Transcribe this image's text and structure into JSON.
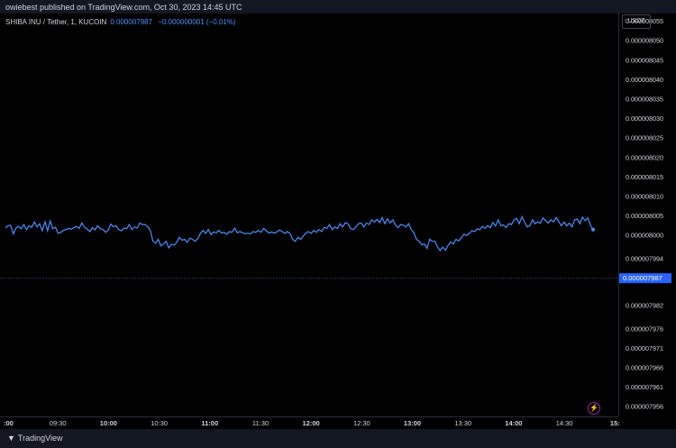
{
  "header": {
    "published_text": "owiebest published on TradingView.com, Oct 30, 2023 14:45 UTC"
  },
  "legend": {
    "symbol": "SHIBA INU / Tether, 1, KUCOIN",
    "value": "0.000007987",
    "change": "−0.000000001 (−0.01%)"
  },
  "scale": {
    "currency": "USDT"
  },
  "footer": {
    "brand": "TradingView"
  },
  "colors": {
    "line": "#4e8ff8",
    "background": "#000000",
    "panel": "#131722",
    "price_label": "#2962ff"
  },
  "chart_data": {
    "type": "line",
    "title": "",
    "xlabel": "",
    "ylabel": "",
    "ylim": [
      7.9535e-06,
      8.057e-06
    ],
    "y_ticks": [
      {
        "label": "0.000008055",
        "value": 8.055e-06
      },
      {
        "label": "0.000008050",
        "value": 8.05e-06
      },
      {
        "label": "0.000008045",
        "value": 8.045e-06
      },
      {
        "label": "0.000008040",
        "value": 8.04e-06
      },
      {
        "label": "0.000008035",
        "value": 8.035e-06
      },
      {
        "label": "0.000008030",
        "value": 8.03e-06
      },
      {
        "label": "0.000008025",
        "value": 8.025e-06
      },
      {
        "label": "0.000008020",
        "value": 8.02e-06
      },
      {
        "label": "0.000008015",
        "value": 8.015e-06
      },
      {
        "label": "0.000008010",
        "value": 8.01e-06
      },
      {
        "label": "0.000008005",
        "value": 8.005e-06
      },
      {
        "label": "0.000008000",
        "value": 8e-06
      },
      {
        "label": "0.000007994",
        "value": 7.994e-06
      },
      {
        "label": "0.000007982",
        "value": 7.982e-06
      },
      {
        "label": "0.000007976",
        "value": 7.976e-06
      },
      {
        "label": "0.000007971",
        "value": 7.971e-06
      },
      {
        "label": "0.000007966",
        "value": 7.966e-06
      },
      {
        "label": "0.000007961",
        "value": 7.961e-06
      },
      {
        "label": "0.000007956",
        "value": 7.956e-06
      }
    ],
    "last_price": {
      "label": "0.000007987",
      "value": 7.989e-06
    },
    "x_ticks": [
      {
        "label": ":00",
        "minute": 0,
        "bold": true
      },
      {
        "label": "09:30",
        "minute": 30,
        "bold": false
      },
      {
        "label": "10:00",
        "minute": 60,
        "bold": true
      },
      {
        "label": "10:30",
        "minute": 90,
        "bold": false
      },
      {
        "label": "11:00",
        "minute": 120,
        "bold": true
      },
      {
        "label": "11:30",
        "minute": 150,
        "bold": false
      },
      {
        "label": "12:00",
        "minute": 180,
        "bold": true
      },
      {
        "label": "12:30",
        "minute": 210,
        "bold": false
      },
      {
        "label": "13:00",
        "minute": 240,
        "bold": true
      },
      {
        "label": "13:30",
        "minute": 270,
        "bold": false
      },
      {
        "label": "14:00",
        "minute": 300,
        "bold": true
      },
      {
        "label": "14:30",
        "minute": 330,
        "bold": false
      },
      {
        "label": "15:",
        "minute": 360,
        "bold": true
      }
    ],
    "series": [
      {
        "points": [
          [
            0,
            8.0019e-06
          ],
          [
            1,
            8.0025e-06
          ],
          [
            2,
            8.0026e-06
          ],
          [
            3,
            8.0004e-06
          ],
          [
            4,
            8.0019e-06
          ],
          [
            5,
            8.0023e-06
          ],
          [
            6,
            8.0017e-06
          ],
          [
            7,
            8.0028e-06
          ],
          [
            8,
            8.0015e-06
          ],
          [
            9,
            8.0025e-06
          ],
          [
            10,
            8.0021e-06
          ],
          [
            11,
            8.0035e-06
          ],
          [
            12,
            8.0022e-06
          ],
          [
            13,
            8.003e-06
          ],
          [
            14,
            8.0012e-06
          ],
          [
            15,
            8.0035e-06
          ],
          [
            16,
            8.0012e-06
          ],
          [
            17,
            8.0037e-06
          ],
          [
            18,
            8.0017e-06
          ],
          [
            19,
            8.0021e-06
          ],
          [
            20,
            8.0005e-06
          ],
          [
            21,
            8.0008e-06
          ],
          [
            22,
            8.0013e-06
          ],
          [
            23,
            8.0015e-06
          ],
          [
            24,
            8.0018e-06
          ],
          [
            25,
            8.0016e-06
          ],
          [
            26,
            8.002e-06
          ],
          [
            27,
            8.0023e-06
          ],
          [
            28,
            8.0018e-06
          ],
          [
            29,
            8.0032e-06
          ],
          [
            30,
            8.0021e-06
          ],
          [
            31,
            8.0017e-06
          ],
          [
            32,
            8.001e-06
          ],
          [
            33,
            8.002e-06
          ],
          [
            34,
            8.0014e-06
          ],
          [
            35,
            8.0025e-06
          ],
          [
            36,
            8.0017e-06
          ],
          [
            37,
            8.0015e-06
          ],
          [
            38,
            8.0008e-06
          ],
          [
            39,
            8.0013e-06
          ],
          [
            40,
            8.0029e-06
          ],
          [
            41,
            8.0022e-06
          ],
          [
            42,
            8.0025e-06
          ],
          [
            43,
            8.0015e-06
          ],
          [
            44,
            8.0012e-06
          ],
          [
            45,
            8.0019e-06
          ],
          [
            46,
            8.0017e-06
          ],
          [
            47,
            8.0028e-06
          ],
          [
            48,
            8.0015e-06
          ],
          [
            49,
            8.0022e-06
          ],
          [
            50,
            8.0019e-06
          ],
          [
            51,
            8.0032e-06
          ],
          [
            52,
            8.0028e-06
          ],
          [
            53,
            8.0028e-06
          ],
          [
            54,
            8.0022e-06
          ],
          [
            55,
            8.0013e-06
          ],
          [
            56,
            7.9985e-06
          ],
          [
            57,
            7.998e-06
          ],
          [
            58,
            7.999e-06
          ],
          [
            59,
            7.9973e-06
          ],
          [
            60,
            7.9978e-06
          ],
          [
            61,
            7.9985e-06
          ],
          [
            62,
            7.9968e-06
          ],
          [
            63,
            7.9978e-06
          ],
          [
            64,
            7.9975e-06
          ],
          [
            65,
            7.9982e-06
          ],
          [
            66,
            7.9995e-06
          ],
          [
            67,
            7.9988e-06
          ],
          [
            68,
            7.999e-06
          ],
          [
            69,
            7.9982e-06
          ],
          [
            70,
            7.9993e-06
          ],
          [
            71,
            7.999e-06
          ],
          [
            72,
            7.9985e-06
          ],
          [
            73,
            7.9992e-06
          ],
          [
            74,
            8.0005e-06
          ],
          [
            75,
            8.0013e-06
          ],
          [
            76,
            8.0005e-06
          ],
          [
            77,
            8.0015e-06
          ],
          [
            78,
            8.0002e-06
          ],
          [
            79,
            8.0009e-06
          ],
          [
            80,
            8.0007e-06
          ],
          [
            81,
            8.0013e-06
          ],
          [
            82,
            8.0006e-06
          ],
          [
            83,
            8.0008e-06
          ],
          [
            84,
            8.0003e-06
          ],
          [
            85,
            8.001e-06
          ],
          [
            86,
            8.0008e-06
          ],
          [
            87,
            8.0019e-06
          ],
          [
            88,
            8.0007e-06
          ],
          [
            89,
            8.001e-06
          ],
          [
            90,
            8.0007e-06
          ],
          [
            91,
            8.0004e-06
          ],
          [
            92,
            8.0006e-06
          ],
          [
            93,
            8.0004e-06
          ],
          [
            94,
            8.001e-06
          ],
          [
            95,
            8.0008e-06
          ],
          [
            96,
            8.0013e-06
          ],
          [
            97,
            8.0008e-06
          ],
          [
            98,
            8.0018e-06
          ],
          [
            99,
            8.0012e-06
          ],
          [
            100,
            8.0006e-06
          ],
          [
            101,
            8.0009e-06
          ],
          [
            102,
            8.0006e-06
          ],
          [
            103,
            8.0009e-06
          ],
          [
            104,
            8.0014e-06
          ],
          [
            105,
            8.001e-06
          ],
          [
            106,
            8.0005e-06
          ],
          [
            107,
            8.001e-06
          ],
          [
            108,
            8.0005e-06
          ],
          [
            109,
            7.999e-06
          ],
          [
            110,
            7.9985e-06
          ],
          [
            111,
            7.9995e-06
          ],
          [
            112,
            7.999e-06
          ],
          [
            113,
            7.9998e-06
          ],
          [
            114,
            8.0006e-06
          ],
          [
            115,
            8.001e-06
          ],
          [
            116,
            8.0005e-06
          ],
          [
            117,
            8.0013e-06
          ],
          [
            118,
            8.0008e-06
          ],
          [
            119,
            8.0015e-06
          ],
          [
            120,
            8.001e-06
          ],
          [
            121,
            8.0021e-06
          ],
          [
            122,
            8.0018e-06
          ],
          [
            123,
            8.0028e-06
          ],
          [
            124,
            8.0015e-06
          ],
          [
            125,
            8.0022e-06
          ],
          [
            126,
            8.0018e-06
          ],
          [
            127,
            8.003e-06
          ],
          [
            128,
            8.0022e-06
          ],
          [
            129,
            8.0033e-06
          ],
          [
            130,
            8.003e-06
          ],
          [
            131,
            8.0018e-06
          ],
          [
            132,
            8.0015e-06
          ],
          [
            133,
            8.0022e-06
          ],
          [
            134,
            8.003e-06
          ],
          [
            135,
            8.0032e-06
          ],
          [
            136,
            8.0022e-06
          ],
          [
            137,
            8.0032e-06
          ],
          [
            138,
            8.0028e-06
          ],
          [
            139,
            8.004e-06
          ],
          [
            140,
            8.0035e-06
          ],
          [
            141,
            8.0041e-06
          ],
          [
            142,
            8.0033e-06
          ],
          [
            143,
            8.0046e-06
          ],
          [
            144,
            8.003e-06
          ],
          [
            145,
            8.0043e-06
          ],
          [
            146,
            8.0032e-06
          ],
          [
            147,
            8.004e-06
          ],
          [
            148,
            8.0027e-06
          ],
          [
            149,
            8.002e-06
          ],
          [
            150,
            8.0028e-06
          ],
          [
            151,
            8.0026e-06
          ],
          [
            152,
            8.0022e-06
          ],
          [
            153,
            8.003e-06
          ],
          [
            154,
            8.0015e-06
          ],
          [
            155,
            8.0007e-06
          ],
          [
            156,
            7.999e-06
          ],
          [
            157,
            7.9985e-06
          ],
          [
            158,
            7.9976e-06
          ],
          [
            159,
            7.9978e-06
          ],
          [
            160,
            7.9967e-06
          ],
          [
            161,
            7.999e-06
          ],
          [
            162,
            7.9985e-06
          ],
          [
            163,
            7.9985e-06
          ],
          [
            164,
            7.997e-06
          ],
          [
            165,
            7.9961e-06
          ],
          [
            166,
            7.997e-06
          ],
          [
            167,
            7.9962e-06
          ],
          [
            168,
            7.9975e-06
          ],
          [
            169,
            7.9983e-06
          ],
          [
            170,
            7.9978e-06
          ],
          [
            171,
            7.999e-06
          ],
          [
            172,
            7.9986e-06
          ],
          [
            173,
            7.9994e-06
          ],
          [
            174,
            8.0003e-06
          ],
          [
            175,
            8e-06
          ],
          [
            176,
            8.0005e-06
          ],
          [
            177,
            8.0012e-06
          ],
          [
            178,
            8.001e-06
          ],
          [
            179,
            8.0017e-06
          ],
          [
            180,
            8.0015e-06
          ],
          [
            181,
            8.0023e-06
          ],
          [
            182,
            8.0018e-06
          ],
          [
            183,
            8.0025e-06
          ],
          [
            184,
            8.002e-06
          ],
          [
            185,
            8.0033e-06
          ],
          [
            186,
            8.0024e-06
          ],
          [
            187,
            8.004e-06
          ],
          [
            188,
            8.0025e-06
          ],
          [
            189,
            8.0027e-06
          ],
          [
            190,
            8.002e-06
          ],
          [
            191,
            8.003e-06
          ],
          [
            192,
            8.0028e-06
          ],
          [
            193,
            8.004e-06
          ],
          [
            194,
            8.0044e-06
          ],
          [
            195,
            8.003e-06
          ],
          [
            196,
            8.0048e-06
          ],
          [
            197,
            8.0034e-06
          ],
          [
            198,
            8.0022e-06
          ],
          [
            199,
            8.0025e-06
          ],
          [
            200,
            8.004e-06
          ],
          [
            201,
            8.003e-06
          ],
          [
            202,
            8.0035e-06
          ],
          [
            203,
            8.0031e-06
          ],
          [
            204,
            8.0045e-06
          ],
          [
            205,
            8.0038e-06
          ],
          [
            206,
            8.0032e-06
          ],
          [
            207,
            8.004e-06
          ],
          [
            208,
            8.0035e-06
          ],
          [
            209,
            8.0046e-06
          ],
          [
            210,
            8.0035e-06
          ],
          [
            211,
            8.0025e-06
          ],
          [
            212,
            8.0034e-06
          ],
          [
            213,
            8.0025e-06
          ],
          [
            214,
            8.0032e-06
          ],
          [
            215,
            8.0022e-06
          ],
          [
            216,
            8.004e-06
          ],
          [
            217,
            8.0042e-06
          ],
          [
            218,
            8.003e-06
          ],
          [
            219,
            8.0047e-06
          ],
          [
            220,
            8.0038e-06
          ],
          [
            221,
            8.0045e-06
          ],
          [
            222,
            8.0026e-06
          ],
          [
            223,
            8.0015e-06
          ]
        ]
      }
    ]
  }
}
